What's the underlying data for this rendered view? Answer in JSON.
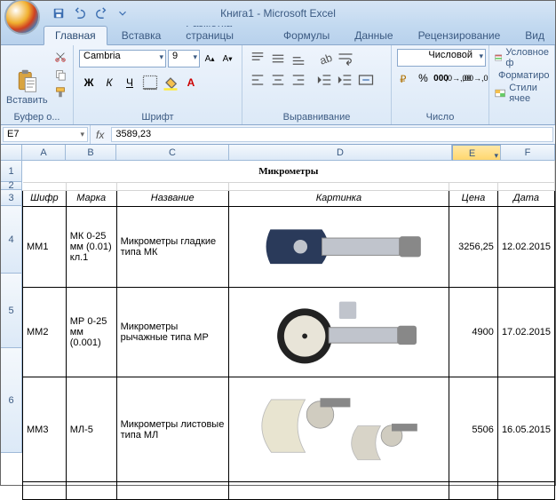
{
  "window": {
    "title": "Книга1 - Microsoft Excel"
  },
  "tabs": [
    "Главная",
    "Вставка",
    "Разметка страницы",
    "Формулы",
    "Данные",
    "Рецензирование",
    "Вид"
  ],
  "ribbon": {
    "clipboard": {
      "paste": "Вставить",
      "label": "Буфер о..."
    },
    "font": {
      "name": "Cambria",
      "size": "9",
      "label": "Шрифт"
    },
    "align": {
      "label": "Выравнивание"
    },
    "number": {
      "format": "Числовой",
      "label": "Число"
    },
    "styles": {
      "cond": "Условное ф",
      "fmt": "Форматиро",
      "cell": "Стили ячее"
    }
  },
  "fbar": {
    "ref": "E7",
    "formula": "3589,23"
  },
  "cols": [
    "A",
    "B",
    "C",
    "D",
    "E",
    "F"
  ],
  "rows": [
    "1",
    "2",
    "3",
    "4",
    "5",
    "6"
  ],
  "sheet": {
    "title": "Микрометры",
    "headers": {
      "a": "Шифр",
      "b": "Марка",
      "c": "Название",
      "d": "Картинка",
      "e": "Цена",
      "f": "Дата"
    },
    "r4": {
      "a": "ММ1",
      "b": "МК 0-25 мм (0.01) кл.1",
      "c": "Микрометры гладкие типа МК",
      "e": "3256,25",
      "f": "12.02.2015"
    },
    "r5": {
      "a": "ММ2",
      "b": "МР 0-25 мм (0.001)",
      "c": "Микрометры рычажные типа МР",
      "e": "4900",
      "f": "17.02.2015"
    },
    "r6": {
      "a": "ММ3",
      "b": "МЛ-5",
      "c": "Микрометры листовые типа МЛ",
      "e": "5506",
      "f": "16.05.2015"
    }
  }
}
